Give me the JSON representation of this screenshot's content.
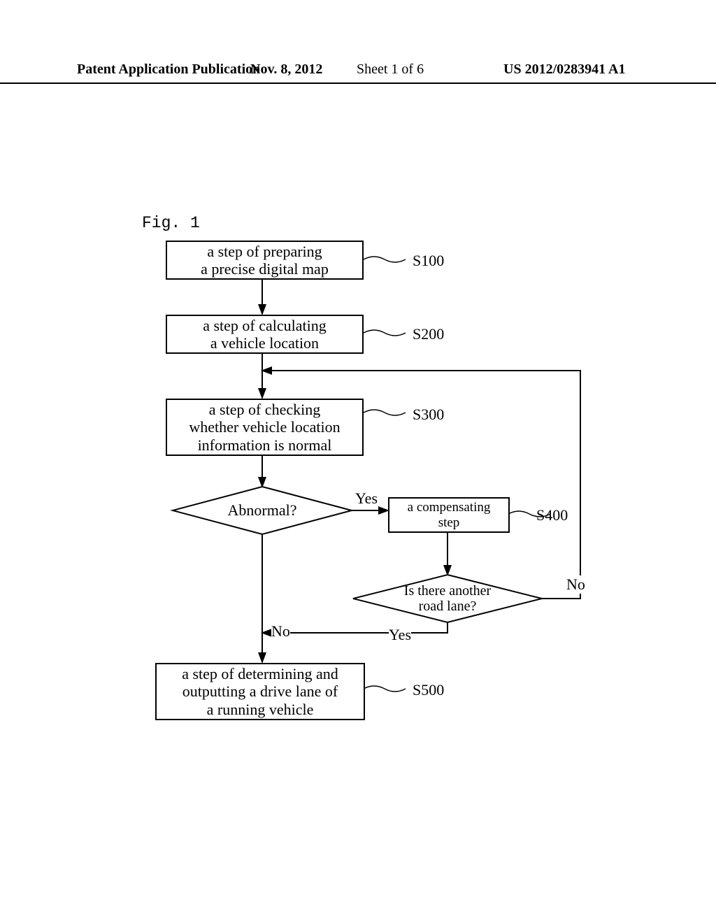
{
  "header": {
    "left": "Patent Application Publication",
    "date": "Nov. 8, 2012",
    "sheet": "Sheet 1 of 6",
    "pubno": "US 2012/0283941 A1"
  },
  "figure_label": "Fig. 1",
  "steps": {
    "s100": {
      "text": "a step of preparing\na precise digital map",
      "label": "S100"
    },
    "s200": {
      "text": "a step of calculating\na vehicle location",
      "label": "S200"
    },
    "s300": {
      "text": "a step of checking\nwhether vehicle location\ninformation is normal",
      "label": "S300"
    },
    "s400": {
      "text": "a compensating\nstep",
      "label": "S400"
    },
    "s500": {
      "text": "a step of determining and\noutputting a drive lane of\na running vehicle",
      "label": "S500"
    }
  },
  "decisions": {
    "abnormal": {
      "text": "Abnormal?",
      "yes": "Yes",
      "no": "No"
    },
    "another_lane": {
      "text": "Is there another\nroad lane?",
      "yes": "Yes",
      "no": "No"
    }
  },
  "chart_data": {
    "type": "flowchart",
    "nodes": [
      {
        "id": "S100",
        "type": "process",
        "label": "a step of preparing a precise digital map"
      },
      {
        "id": "S200",
        "type": "process",
        "label": "a step of calculating a vehicle location"
      },
      {
        "id": "S300",
        "type": "process",
        "label": "a step of checking whether vehicle location information is normal"
      },
      {
        "id": "D1",
        "type": "decision",
        "label": "Abnormal?"
      },
      {
        "id": "S400",
        "type": "process",
        "label": "a compensating step"
      },
      {
        "id": "D2",
        "type": "decision",
        "label": "Is there another road lane?"
      },
      {
        "id": "S500",
        "type": "process",
        "label": "a step of determining and outputting a drive lane of a running vehicle"
      }
    ],
    "edges": [
      {
        "from": "S100",
        "to": "S200",
        "label": ""
      },
      {
        "from": "S200",
        "to": "S300",
        "label": ""
      },
      {
        "from": "S300",
        "to": "D1",
        "label": ""
      },
      {
        "from": "D1",
        "to": "S400",
        "label": "Yes"
      },
      {
        "from": "D1",
        "to": "S500",
        "label": "No"
      },
      {
        "from": "S400",
        "to": "D2",
        "label": ""
      },
      {
        "from": "D2",
        "to": "S500",
        "label": "Yes"
      },
      {
        "from": "D2",
        "to": "S300",
        "label": "No"
      }
    ]
  }
}
